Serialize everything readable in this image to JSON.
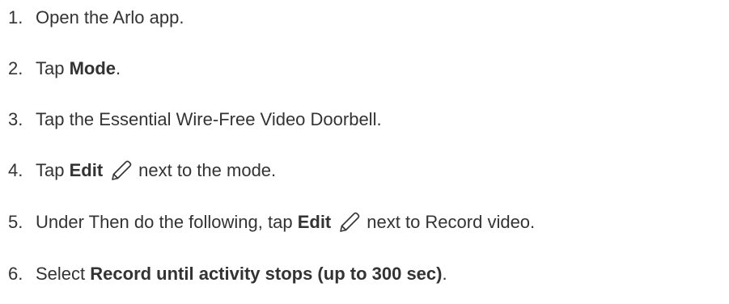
{
  "steps": [
    {
      "number": "1.",
      "text": "Open the Arlo app."
    },
    {
      "number": "2.",
      "pre": "Tap ",
      "bold": "Mode",
      "post": "."
    },
    {
      "number": "3.",
      "text": "Tap the Essential Wire-Free Video Doorbell."
    },
    {
      "number": "4.",
      "pre": "Tap ",
      "bold": "Edit",
      "icon": "pencil-edit-icon",
      "post": "next to the mode."
    },
    {
      "number": "5.",
      "pre": "Under Then do the following, tap ",
      "bold": "Edit",
      "icon": "pencil-edit-icon",
      "post": "next to Record video."
    },
    {
      "number": "6.",
      "pre": "Select ",
      "bold": "Record until activity stops (up to 300 sec)",
      "post": "."
    }
  ]
}
